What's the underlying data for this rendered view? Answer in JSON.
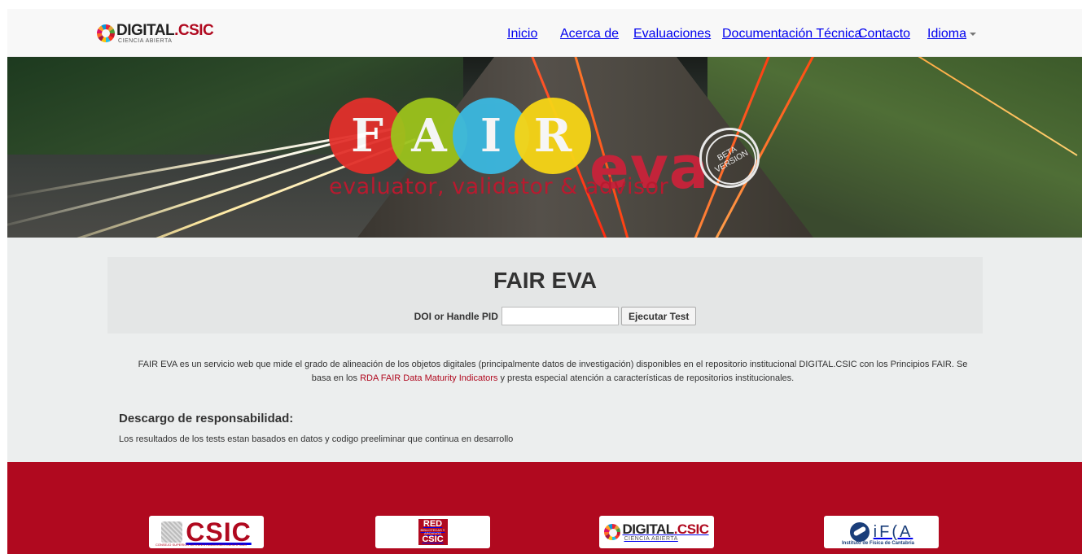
{
  "navbar": {
    "brand_main_1": "DIGITAL",
    "brand_main_2": ".CSIC",
    "brand_sub": "CIENCIA ABIERTA",
    "items": [
      {
        "label": "Inicio"
      },
      {
        "label": "Acerca de"
      },
      {
        "label": "Evaluaciones"
      },
      {
        "label": "Documentación Técnica"
      },
      {
        "label": "Contacto"
      },
      {
        "label": "Idioma"
      }
    ]
  },
  "hero": {
    "letters": [
      "F",
      "A",
      "I",
      "R"
    ],
    "eva": "eva",
    "tagline": "evaluator, validator & advisor",
    "beta": "BETA VERSION"
  },
  "main": {
    "title": "FAIR EVA",
    "pid_label": "DOI or Handle PID",
    "pid_value": "",
    "pid_placeholder": "",
    "submit_label": "Ejecutar Test",
    "description_1": "FAIR EVA es un servicio web que mide el grado de alineación de los objetos digitales (principalmente datos de investigación) disponibles en el repositorio institucional DIGITAL.CSIC con los Principios FAIR. Se basa en los ",
    "description_link": "RDA FAIR Data Maturity Indicators",
    "description_2": " y presta especial atención a características de repositorios institucionales.",
    "disclaimer_title": "Descargo de responsabilidad:",
    "disclaimer_text": "Los resultados de los tests estan basados en datos y codigo preeliminar que continua en desarrollo"
  },
  "footer": {
    "logo_csic": "CSIC",
    "logo_csic_sub": "CONSEJO SUPERIOR DE INVESTIGACIONES CIENTÍFICAS",
    "logo_red_1": "RED",
    "logo_red_small": "BIBLIOTECAS Y ARCHIVOS",
    "logo_red_2": "CSIC",
    "logo_digital_1": "DIGITAL",
    "logo_digital_2": ".CSIC",
    "logo_digital_sub": "CIENCIA ABIERTA",
    "logo_ifca": "iF(A",
    "logo_ifca_sub": "Instituto de Física de Cantabria"
  },
  "colors": {
    "brand_red": "#b0091f",
    "circle_f": "#e2302b",
    "circle_a": "#9cc21c",
    "circle_i": "#3bb8e0",
    "circle_r": "#f7d516"
  }
}
